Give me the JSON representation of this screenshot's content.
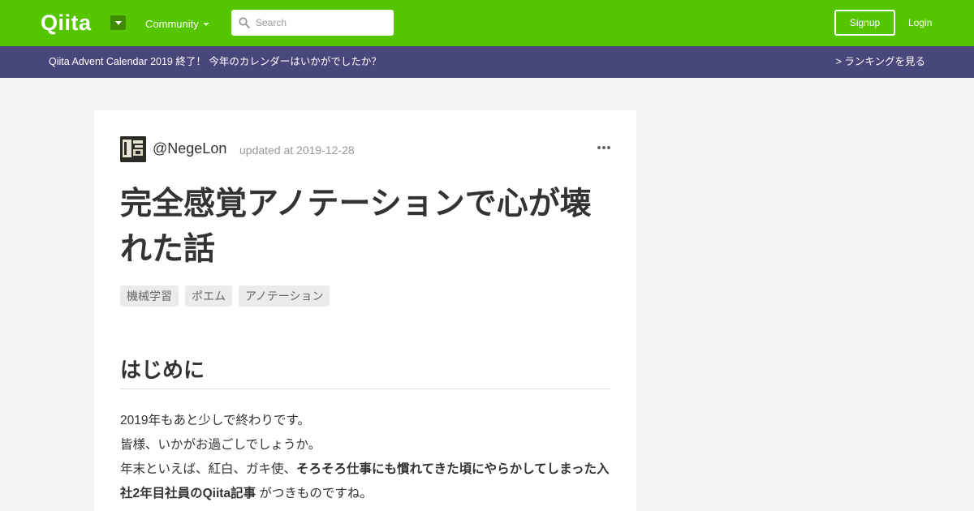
{
  "header": {
    "logo": "Qiita",
    "community_label": "Community",
    "search_placeholder": "Search",
    "signup_label": "Signup",
    "login_label": "Login"
  },
  "banner": {
    "text": "Qiita Advent Calendar 2019 終了！ 今年のカレンダーはいかがでしたか？",
    "link": "> ランキングを見る"
  },
  "article": {
    "author": "@NegeLon",
    "updated": "updated at 2019-12-28",
    "title": "完全感覚アノテーションで心が壊れた話",
    "tags": [
      "機械学習",
      "ポエム",
      "アノテーション"
    ],
    "section_heading": "はじめに",
    "paragraph": {
      "line1": "2019年もあと少しで終わりです。",
      "line2": "皆様、いかがお過ごしでしょうか。",
      "line3_prefix": "年末といえば、紅白、ガキ使、",
      "line3_bold": "そろそろ仕事にも慣れてきた頃にやらかしてしまった入社2年目社員のQiita記事",
      "line3_suffix": " がつきものですね。"
    }
  },
  "colors": {
    "header_bg": "#55c500",
    "banner_bg": "#48477c",
    "page_bg": "#f5f5f4",
    "card_bg": "#ffffff"
  },
  "icons": [
    "search-icon",
    "logo-dropdown-icon",
    "community-caret-icon",
    "more-options-icon",
    "author-avatar"
  ]
}
